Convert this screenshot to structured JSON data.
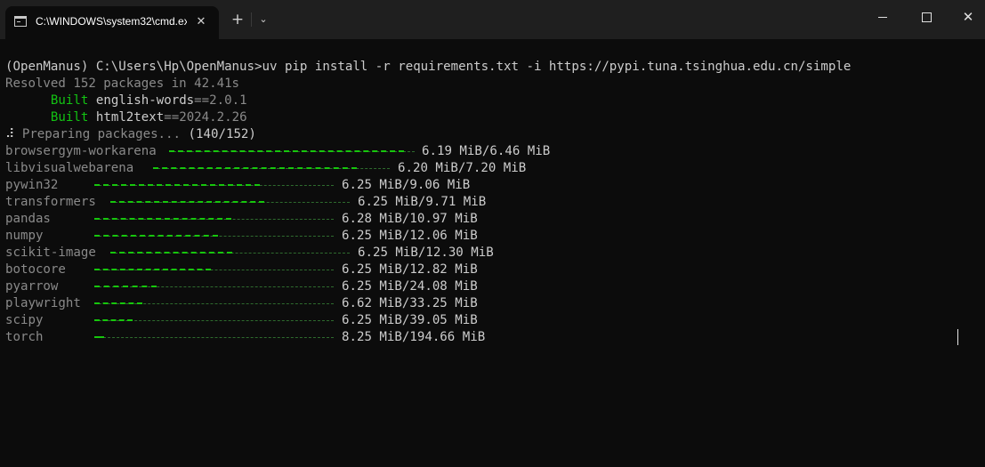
{
  "window": {
    "tab_title": "C:\\WINDOWS\\system32\\cmd.exe",
    "close_tab_glyph": "✕",
    "new_tab_glyph": "+",
    "dropdown_glyph": "⌄",
    "minimize_label": "",
    "close_glyph": "✕"
  },
  "colors": {
    "background": "#0c0c0c",
    "titlebar": "#1f1f1f",
    "text": "#cccccc",
    "dim_text": "#8a8a8a",
    "green": "#16c60c"
  },
  "terminal": {
    "command_line": "(OpenManus) C:\\Users\\Hp\\OpenManus>uv pip install -r requirements.txt -i https://pypi.tuna.tsinghua.edu.cn/simple",
    "resolved": "Resolved 152 packages in 42.41s",
    "built": [
      {
        "keyword": "Built",
        "name": "english-words",
        "version": "==2.0.1"
      },
      {
        "keyword": "Built",
        "name": "html2text",
        "version": "==2024.2.26"
      }
    ],
    "preparing_spinner": "⠼",
    "preparing_text": "Preparing packages...",
    "preparing_count": "(140/152)",
    "packages": [
      {
        "name": "browsergym-workarena",
        "progress": 0.958,
        "size": "6.19 MiB/6.46 MiB"
      },
      {
        "name": "libvisualwebarena",
        "progress": 0.861,
        "size": "6.20 MiB/7.20 MiB"
      },
      {
        "name": "pywin32",
        "progress": 0.69,
        "size": "6.25 MiB/9.06 MiB"
      },
      {
        "name": "transformers",
        "progress": 0.644,
        "size": "6.25 MiB/9.71 MiB"
      },
      {
        "name": "pandas",
        "progress": 0.572,
        "size": "6.28 MiB/10.97 MiB"
      },
      {
        "name": "numpy",
        "progress": 0.518,
        "size": "6.25 MiB/12.06 MiB"
      },
      {
        "name": "scikit-image",
        "progress": 0.508,
        "size": "6.25 MiB/12.30 MiB"
      },
      {
        "name": "botocore",
        "progress": 0.488,
        "size": "6.25 MiB/12.82 MiB"
      },
      {
        "name": "pyarrow",
        "progress": 0.26,
        "size": "6.25 MiB/24.08 MiB"
      },
      {
        "name": "playwright",
        "progress": 0.199,
        "size": "6.62 MiB/33.25 MiB"
      },
      {
        "name": "scipy",
        "progress": 0.16,
        "size": "6.25 MiB/39.05 MiB"
      },
      {
        "name": "torch",
        "progress": 0.042,
        "size": "8.25 MiB/194.66 MiB"
      }
    ]
  }
}
